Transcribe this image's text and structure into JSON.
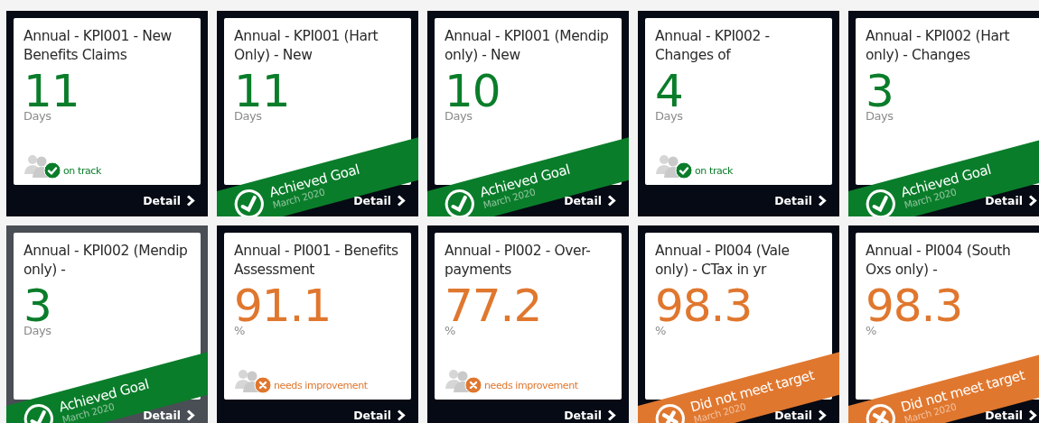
{
  "tiles": [
    {
      "title": "Annual - KPI001 - New Benefits Claims",
      "value": "11",
      "unit": "Days",
      "on_target": true,
      "kind": "status",
      "status": "on track",
      "selected": false,
      "link": "Detail"
    },
    {
      "title": "Annual - KPI001 (Hart Only) - New",
      "value": "11",
      "unit": "Days",
      "on_target": true,
      "kind": "ribbon",
      "status": "Achieved Goal",
      "period": "March 2020",
      "selected": false,
      "link": "Detail"
    },
    {
      "title": "Annual - KPI001 (Mendip only) - New",
      "value": "10",
      "unit": "Days",
      "on_target": true,
      "kind": "ribbon",
      "status": "Achieved Goal",
      "period": "March 2020",
      "selected": false,
      "link": "Detail"
    },
    {
      "title": "Annual - KPI002 - Changes of",
      "value": "4",
      "unit": "Days",
      "on_target": true,
      "kind": "status",
      "status": "on track",
      "selected": false,
      "link": "Detail"
    },
    {
      "title": "Annual - KPI002 (Hart only) - Changes",
      "value": "3",
      "unit": "Days",
      "on_target": true,
      "kind": "ribbon",
      "status": "Achieved Goal",
      "period": "March 2020",
      "selected": false,
      "link": "Detail"
    },
    {
      "title": "Annual - KPI002 (Mendip only) -",
      "value": "3",
      "unit": "Days",
      "on_target": true,
      "kind": "ribbon",
      "status": "Achieved Goal",
      "period": "March 2020",
      "selected": true,
      "link": "Detail"
    },
    {
      "title": "Annual - PI001 - Benefits Assessment",
      "value": "91.1",
      "unit": "%",
      "on_target": false,
      "kind": "status",
      "status": "needs improvement",
      "selected": false,
      "link": "Detail"
    },
    {
      "title": "Annual - PI002 - Over-payments",
      "value": "77.2",
      "unit": "%",
      "on_target": false,
      "kind": "status",
      "status": "needs improvement",
      "selected": false,
      "link": "Detail"
    },
    {
      "title": "Annual - PI004 (Vale only) - CTax in yr",
      "value": "98.3",
      "unit": "%",
      "on_target": false,
      "kind": "ribbon",
      "status": "Did not meet target",
      "period": "March 2020",
      "selected": false,
      "link": "Detail"
    },
    {
      "title": "Annual - PI004 (South Oxs only) -",
      "value": "98.3",
      "unit": "%",
      "on_target": false,
      "kind": "ribbon",
      "status": "Did not meet target",
      "period": "March 2020",
      "selected": false,
      "link": "Detail"
    }
  ]
}
